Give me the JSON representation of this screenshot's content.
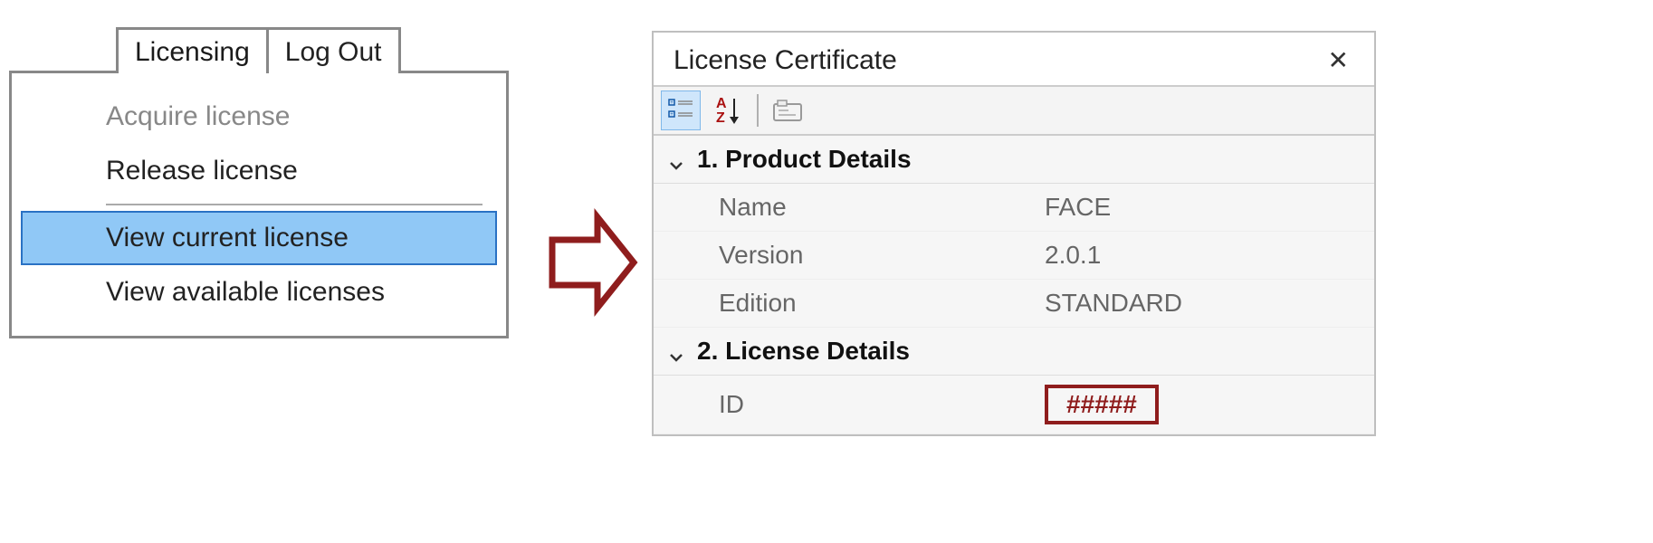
{
  "tabs": {
    "active": "Licensing",
    "other": "Log Out"
  },
  "menu": {
    "acquire": "Acquire license",
    "release": "Release license",
    "view_current": "View current license",
    "view_available": "View available licenses"
  },
  "dialog": {
    "title": "License Certificate",
    "section1": "1. Product Details",
    "section2": "2. License Details",
    "rows": {
      "name_k": "Name",
      "name_v": "FACE",
      "version_k": "Version",
      "version_v": "2.0.1",
      "edition_k": "Edition",
      "edition_v": "STANDARD",
      "id_k": "ID",
      "id_v": "#####"
    }
  }
}
